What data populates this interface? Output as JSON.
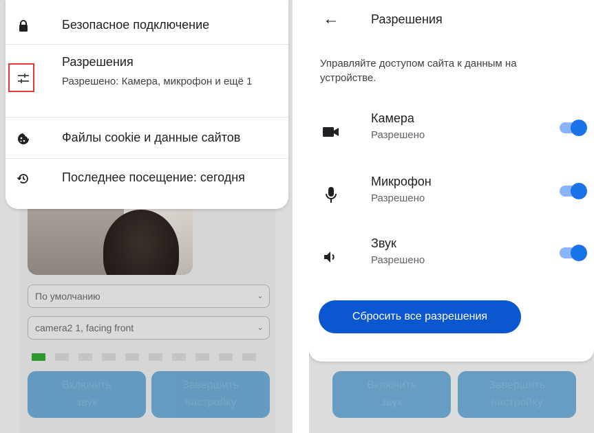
{
  "left": {
    "background": {
      "select_default": "По умолчанию",
      "select_camera": "camera2 1, facing front",
      "btn_sound_line1": "Включить",
      "btn_sound_line2": "звук",
      "btn_finish_line1": "Завершить",
      "btn_finish_line2": "настройку",
      "audio_meter": {
        "active_bars": 1,
        "total_bars": 10
      }
    },
    "menu": {
      "secure": {
        "label": "Безопасное подключение",
        "icon": "lock-icon"
      },
      "permissions": {
        "label": "Разрешения",
        "sub": "Разрешено: Камера, микрофон и ещё 1",
        "icon": "tune-sliders-icon"
      },
      "cookies": {
        "label": "Файлы cookie и данные сайтов",
        "icon": "cookie-icon"
      },
      "last_visit": {
        "label": "Последнее посещение: сегодня",
        "icon": "history-icon"
      }
    }
  },
  "right": {
    "title": "Разрешения",
    "description": "Управляйте доступом сайта к данным на устройстве.",
    "permissions": [
      {
        "name": "Камера",
        "status": "Разрешено",
        "icon": "videocam-icon",
        "enabled": true
      },
      {
        "name": "Микрофон",
        "status": "Разрешено",
        "icon": "mic-icon",
        "enabled": true
      },
      {
        "name": "Звук",
        "status": "Разрешено",
        "icon": "volume-icon",
        "enabled": true
      }
    ],
    "reset_label": "Сбросить все разрешения",
    "background": {
      "btn_sound_line1": "Включить",
      "btn_sound_line2": "звук",
      "btn_finish_line1": "Завершить",
      "btn_finish_line2": "настройку"
    }
  },
  "colors": {
    "accent": "#1a73e8",
    "toggle_track": "#8ab4f8",
    "reset_button": "#0b57d0",
    "highlight_box": "#e53935",
    "meter_active": "#2e9a2e"
  }
}
